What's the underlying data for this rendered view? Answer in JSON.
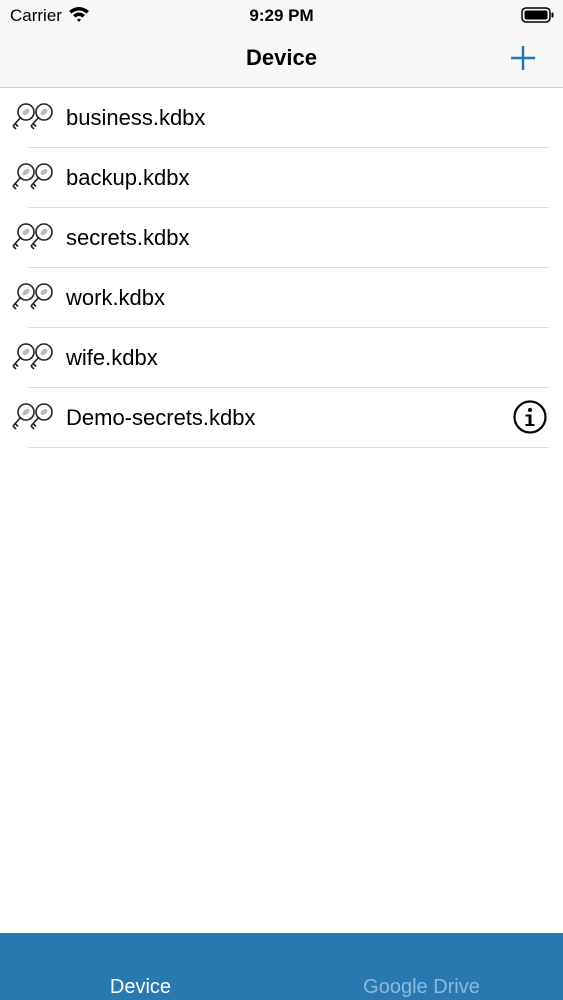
{
  "status": {
    "carrier": "Carrier",
    "time": "9:29 PM"
  },
  "nav": {
    "title": "Device"
  },
  "files": [
    {
      "name": "business.kdbx"
    },
    {
      "name": "backup.kdbx"
    },
    {
      "name": "secrets.kdbx"
    },
    {
      "name": "work.kdbx"
    },
    {
      "name": "wife.kdbx"
    },
    {
      "name": "Demo-secrets.kdbx",
      "info": true
    }
  ],
  "tabs": [
    {
      "label": "Device",
      "active": true
    },
    {
      "label": "Google Drive",
      "active": false
    }
  ],
  "colors": {
    "tint": "#1f78b4",
    "tab_bar": "#2a78b0",
    "tab_inactive": "#8cbbe0"
  }
}
